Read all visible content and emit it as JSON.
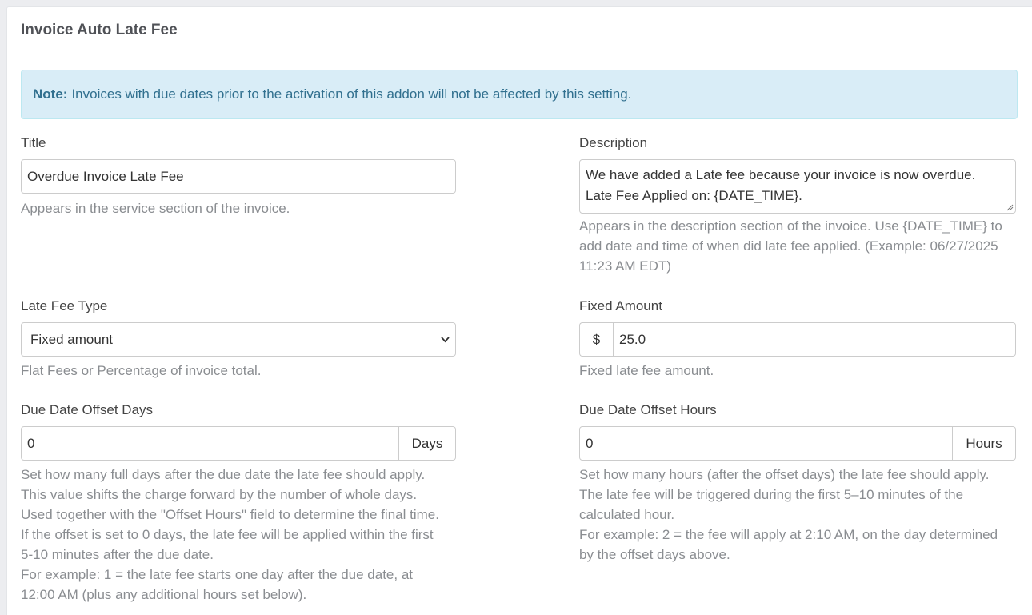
{
  "panel": {
    "title": "Invoice Auto Late Fee"
  },
  "note": {
    "label": "Note:",
    "text": "Invoices with due dates prior to the activation of this addon will not be affected by this setting."
  },
  "title_field": {
    "label": "Title",
    "value": "Overdue Invoice Late Fee",
    "help": "Appears in the service section of the invoice."
  },
  "description_field": {
    "label": "Description",
    "value_line1": "We have added a Late fee because your invoice is now overdue.",
    "value_line2": "Late Fee Applied on: {DATE_TIME}.",
    "help": "Appears in the description section of the invoice. Use {DATE_TIME} to add date and time of when did late fee applied. (Example: 06/27/2025 11:23 AM EDT)"
  },
  "late_fee_type": {
    "label": "Late Fee Type",
    "selected": "Fixed amount",
    "help": "Flat Fees or Percentage of invoice total."
  },
  "fixed_amount": {
    "label": "Fixed Amount",
    "currency_symbol": "$",
    "value": "25.0",
    "help": "Fixed late fee amount."
  },
  "offset_days": {
    "label": "Due Date Offset Days",
    "value": "0",
    "unit": "Days",
    "help_lines": [
      "Set how many full days after the due date the late fee should apply.",
      "This value shifts the charge forward by the number of whole days.",
      "Used together with the \"Offset Hours\" field to determine the final time.",
      "If the offset is set to 0 days, the late fee will be applied within the first",
      "5-10 minutes after the due date.",
      "For example: 1 = the late fee starts one day after the due date, at",
      "12:00 AM (plus any additional hours set below)."
    ]
  },
  "offset_hours": {
    "label": "Due Date Offset Hours",
    "value": "0",
    "unit": "Hours",
    "help_lines": [
      "Set how many hours (after the offset days) the late fee should apply.",
      "The late fee will be triggered during the first 5–10 minutes of the",
      "calculated hour.",
      "For example: 2 = the fee will apply at 2:10 AM, on the day determined",
      "by the offset days above."
    ]
  },
  "icons": {
    "select_chevron": "chevron-down-icon",
    "textarea_resize": "resize-handle-icon"
  }
}
